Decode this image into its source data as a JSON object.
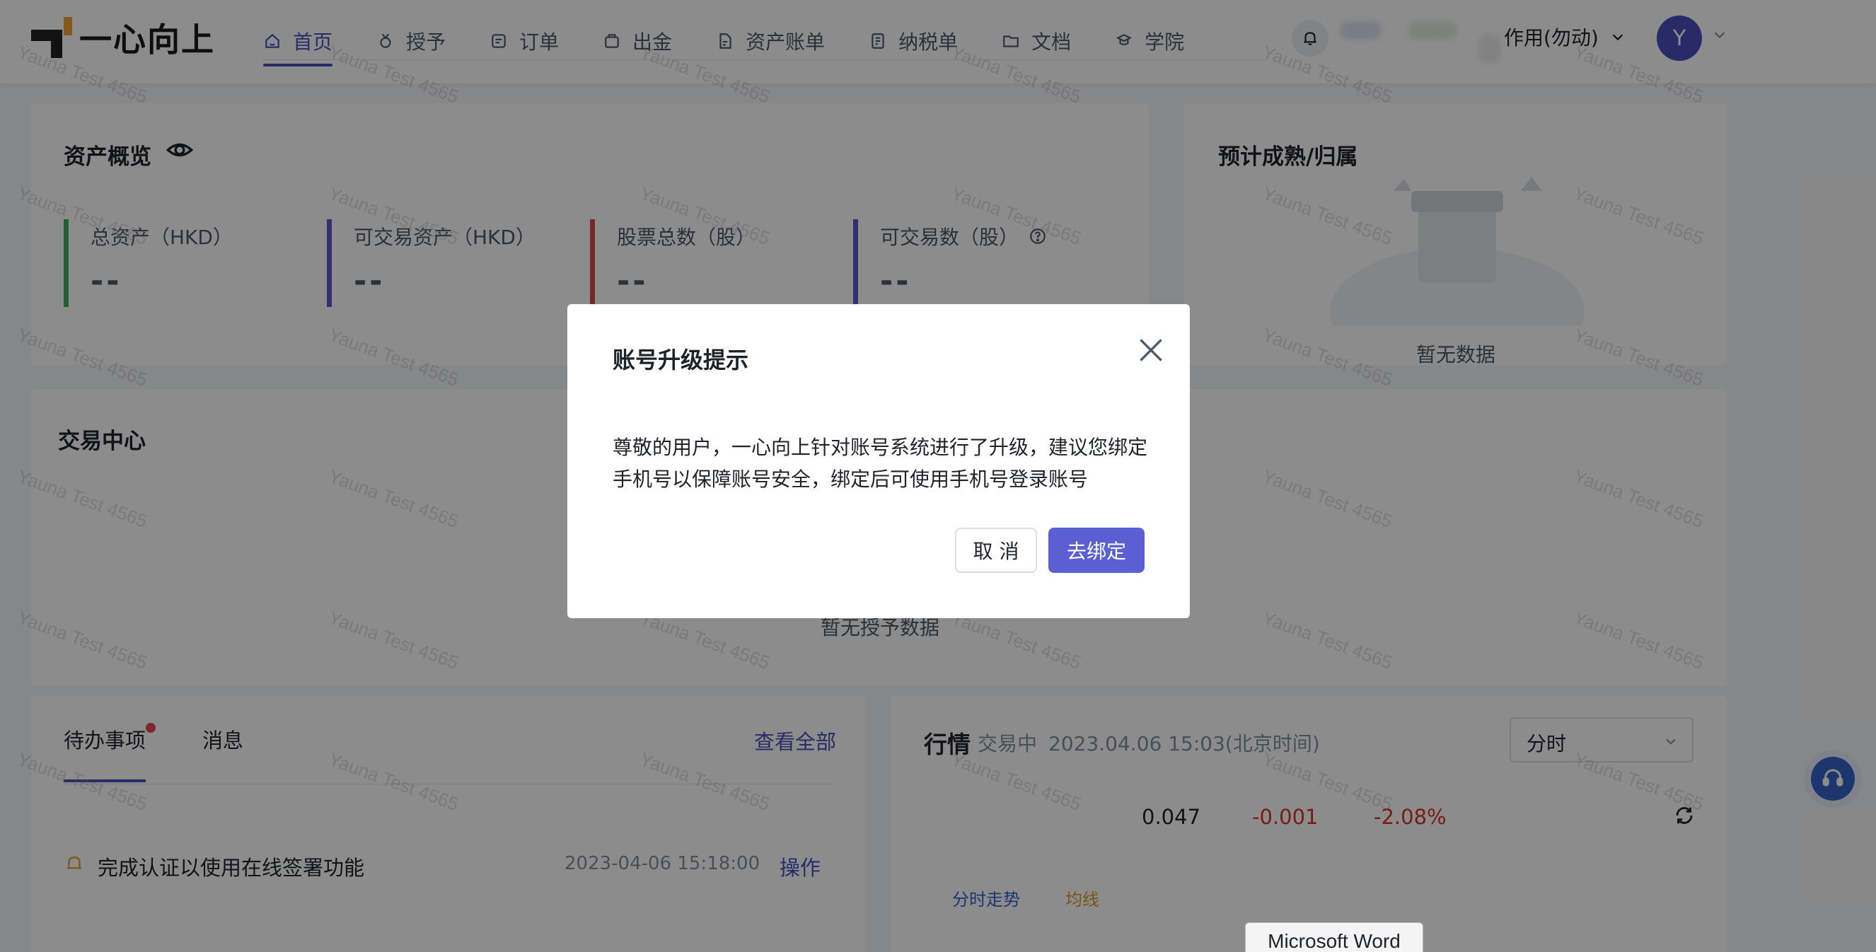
{
  "brand": {
    "name": "一心向上"
  },
  "nav": {
    "items": [
      {
        "label": "首页",
        "icon": "home-icon",
        "active": true
      },
      {
        "label": "授予",
        "icon": "medal-icon"
      },
      {
        "label": "订单",
        "icon": "order-icon"
      },
      {
        "label": "出金",
        "icon": "wallet-icon"
      },
      {
        "label": "资产账单",
        "icon": "document-icon"
      },
      {
        "label": "纳税单",
        "icon": "tax-icon"
      },
      {
        "label": "文档",
        "icon": "folder-icon"
      },
      {
        "label": "学院",
        "icon": "academy-icon"
      }
    ],
    "account_label": "作用(勿动)",
    "avatar_initial": "Y"
  },
  "overview": {
    "title": "资产概览",
    "stats": [
      {
        "label": "总资产（HKD）",
        "value": "--",
        "color": "#3fae5b"
      },
      {
        "label": "可交易资产（HKD）",
        "value": "--",
        "color": "#5b57d1"
      },
      {
        "label": "股票总数（股）",
        "value": "--",
        "color": "#d84c4c"
      },
      {
        "label": "可交易数（股）",
        "value": "--",
        "color": "#5b57d1"
      }
    ]
  },
  "vesting": {
    "title": "预计成熟/归属",
    "empty_text": "暂无数据"
  },
  "trading": {
    "title": "交易中心",
    "empty_text": "暂无授予数据"
  },
  "todo": {
    "tabs": [
      "待办事项",
      "消息"
    ],
    "view_all": "查看全部",
    "items": [
      {
        "text": "完成认证以使用在线签署功能",
        "time": "2023-04-06 15:18:00",
        "action": "操作"
      }
    ]
  },
  "market": {
    "title": "行情",
    "status": "交易中",
    "time": "2023.04.06 15:03(北京时间)",
    "period": "分时",
    "price": "0.047",
    "change": "-0.001",
    "change_pct": "-2.08%",
    "legend": [
      "分时走势",
      "均线"
    ]
  },
  "tooltip": {
    "text": "Microsoft Word"
  },
  "watermark": {
    "text": "Yauna Test 4565"
  },
  "dialog": {
    "title": "账号升级提示",
    "body": "尊敬的用户，一心向上针对账号系统进行了升级，建议您绑定手机号以保障账号安全，绑定后可使用手机号登录账号",
    "cancel": "取 消",
    "confirm": "去绑定"
  },
  "colors": {
    "accent": "#4b4fbf",
    "primary_button": "#5a5fd1",
    "negative": "#d9342b",
    "legend_time": "#3565c9",
    "legend_avg": "#e09a2b",
    "todo_bell": "#f0a33a"
  }
}
